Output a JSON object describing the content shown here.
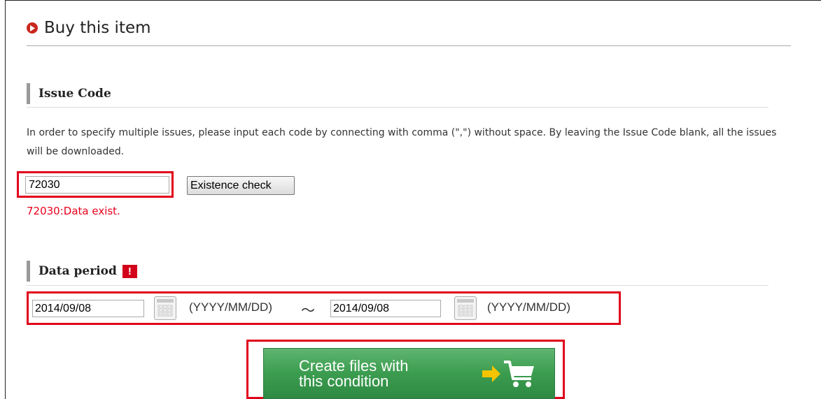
{
  "header": {
    "title": "Buy this item",
    "bullet_icon": "circle-arrow-icon"
  },
  "issue_code": {
    "heading": "Issue Code",
    "description": "In order to specify multiple issues, please input each code by connecting with comma (\",\") without space. By leaving the Issue Code blank, all the issues will be downloaded.",
    "value": "72030",
    "check_button_label": "Existence check",
    "status_message": "72030:Data exist."
  },
  "data_period": {
    "heading": "Data period",
    "required_mark": "!",
    "start_date": "2014/09/08",
    "end_date": "2014/09/08",
    "format_hint": "(YYYY/MM/DD)",
    "separator": "～"
  },
  "action": {
    "create_label": "Create files with\nthis condition",
    "icon": "cart-icon"
  },
  "colors": {
    "accent_red": "#e0001b",
    "button_green": "#3b9c4f",
    "arrow_yellow": "#f5c400"
  }
}
